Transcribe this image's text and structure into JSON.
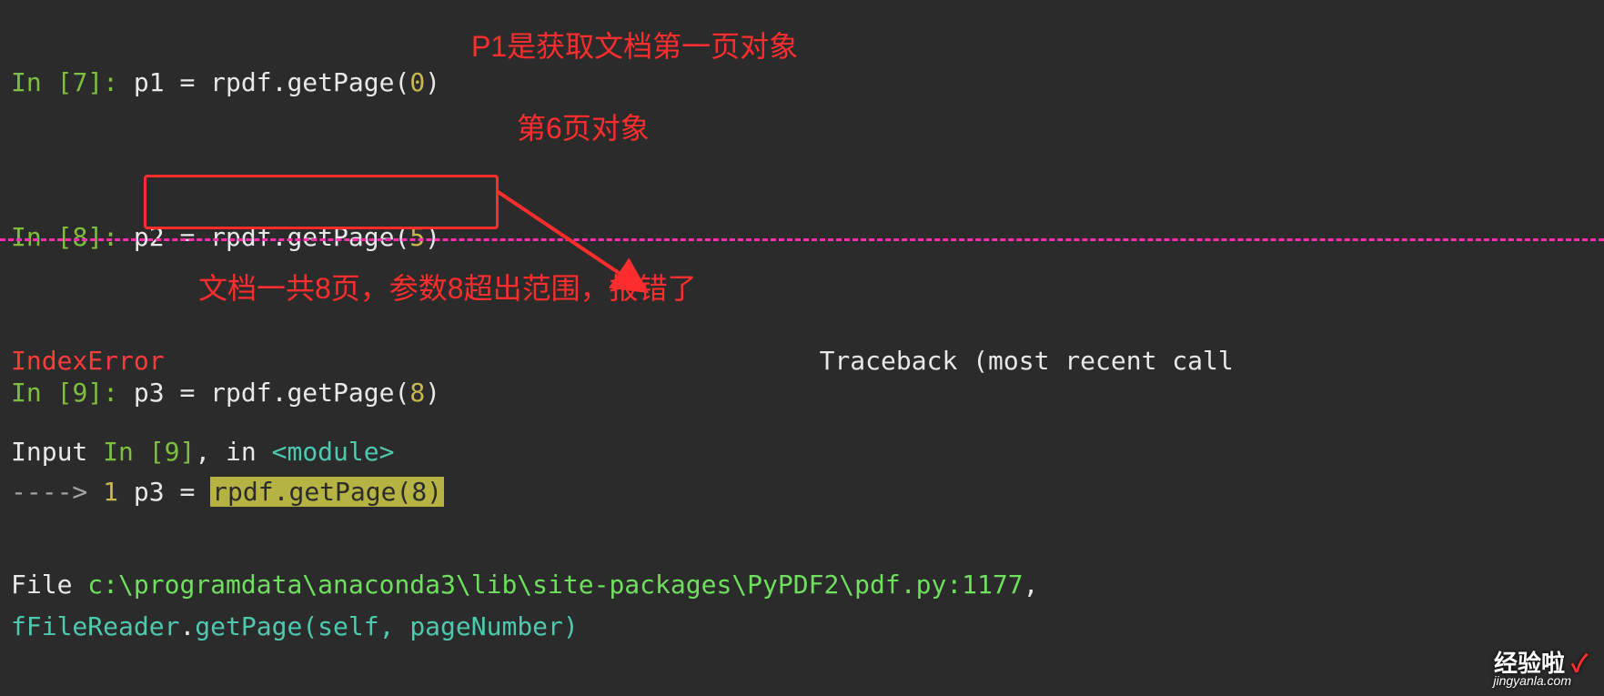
{
  "lines": {
    "l1_prompt": "In [",
    "l1_num": "7",
    "l1_close": "]: ",
    "l1_code_a": "p1 = rpdf.getPage(",
    "l1_arg": "0",
    "l1_code_b": ")",
    "l1_annot": "P1是获取文档第一页对象",
    "l2_prompt": "In [",
    "l2_num": "8",
    "l2_close": "]: ",
    "l2_code_a": "p2 = rpdf.getPage(",
    "l2_arg": "5",
    "l2_code_b": ")",
    "l2_annot": "第6页对象",
    "l3_prompt": "In [",
    "l3_num": "9",
    "l3_close": "]: ",
    "l3_code_a": "p3 = rpdf.getPage(",
    "l3_arg": "8",
    "l3_code_b": ")",
    "mid_annot": "文档一共8页，参数8超出范围，报错了",
    "err_name": "IndexError",
    "traceback": "Traceback (most recent call",
    "input_a": "Input ",
    "input_b": "In [",
    "input_num": "9",
    "input_c": "]",
    "input_d": ", in ",
    "module": "<module>",
    "arrow_line": "----> ",
    "arrow_num": "1",
    "arrow_sp": " ",
    "arrow_code_a": "p3 = ",
    "hl_code": "rpdf.getPage(8)",
    "file_a": "File ",
    "file_path": "c:\\programdata\\anaconda3\\lib\\site-packages\\PyPDF2\\pdf.py:1177",
    "file_b": ",",
    "call_a": "fFileReader",
    "call_b": ".",
    "call_c": "getPage",
    "call_d": "(self, pageNumber)"
  },
  "logo": {
    "text": "经验啦",
    "check": "✓",
    "sub": "jingyanla.com"
  },
  "colors": {
    "bg": "#2b2b2b",
    "prompt": "#7fbf3f",
    "num": "#c8b84d",
    "err": "#ff3b3b",
    "annot": "#ff2d2d",
    "dash": "#ff2db0",
    "path": "#6ee05e",
    "cyan": "#4ec9b0",
    "hl": "#b5b342"
  }
}
